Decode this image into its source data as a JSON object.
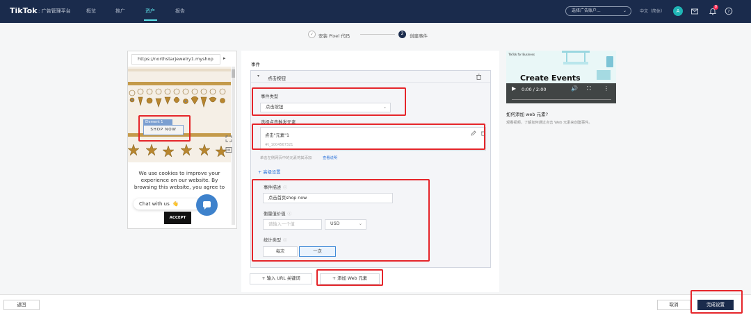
{
  "nav": {
    "brand": "TikTok",
    "brand_sub": ": 广告管理平台",
    "tabs": [
      {
        "label": "概览"
      },
      {
        "label": "推广"
      },
      {
        "label": "资产"
      },
      {
        "label": "报告"
      }
    ],
    "account": "选择广告账户...",
    "language": "中文（简体）",
    "avatar_letter": "A",
    "notification_count": "8"
  },
  "stepper": {
    "step1_label": "安装 Pixel 代码",
    "step2_number": "2",
    "step2_label": "创建事件"
  },
  "preview": {
    "url": "https://northstarjewelry1.myshop",
    "next": "▸",
    "shop_now": "SHOP NOW",
    "element_tag": "Element 1",
    "cookie_text": "We use cookies to improve your experience on our website. By browsing this website, you agree to",
    "chat": "Chat with us",
    "chat_wave": "👋",
    "accept": "ACCEPT"
  },
  "form": {
    "title": "事件",
    "event_name": "点击按钮",
    "event_type_label": "事件类型",
    "event_type_value": "点击按钮",
    "trigger_label": "选择点击触发元素",
    "element_name": "点击\"元素\"1",
    "element_selector": "#t_1004567321",
    "hint": "单击左侧网页中的元素将其添加",
    "hint_link": "查看说明",
    "advanced": "+ 高级设置",
    "event_desc_label": "事件描述",
    "event_desc_value": "点击首页shop now",
    "value_label": "衡量值价值",
    "value_placeholder": "请输入一个值",
    "currency": "USD",
    "count_label": "统计类型",
    "count_options": [
      "每次",
      "一次"
    ],
    "add_url_keyword": "+ 输入 URL 关键词",
    "add_web_element": "+ 添加 Web 元素"
  },
  "video": {
    "brand": "TikTok for Business",
    "title": "Create Events",
    "time": "0:00 / 2:00",
    "question": "如何添加 web 元素?",
    "desc": "观看视频，了解如何通过点击 Web 元素来创建事件。"
  },
  "footer": {
    "back": "返回",
    "cancel": "取消",
    "done": "完成设置"
  },
  "colors": {
    "nav_bg": "#1a2b4c",
    "accent_teal": "#5ee3e9",
    "highlight_red": "#e5252a",
    "link_blue": "#2b73d9"
  }
}
